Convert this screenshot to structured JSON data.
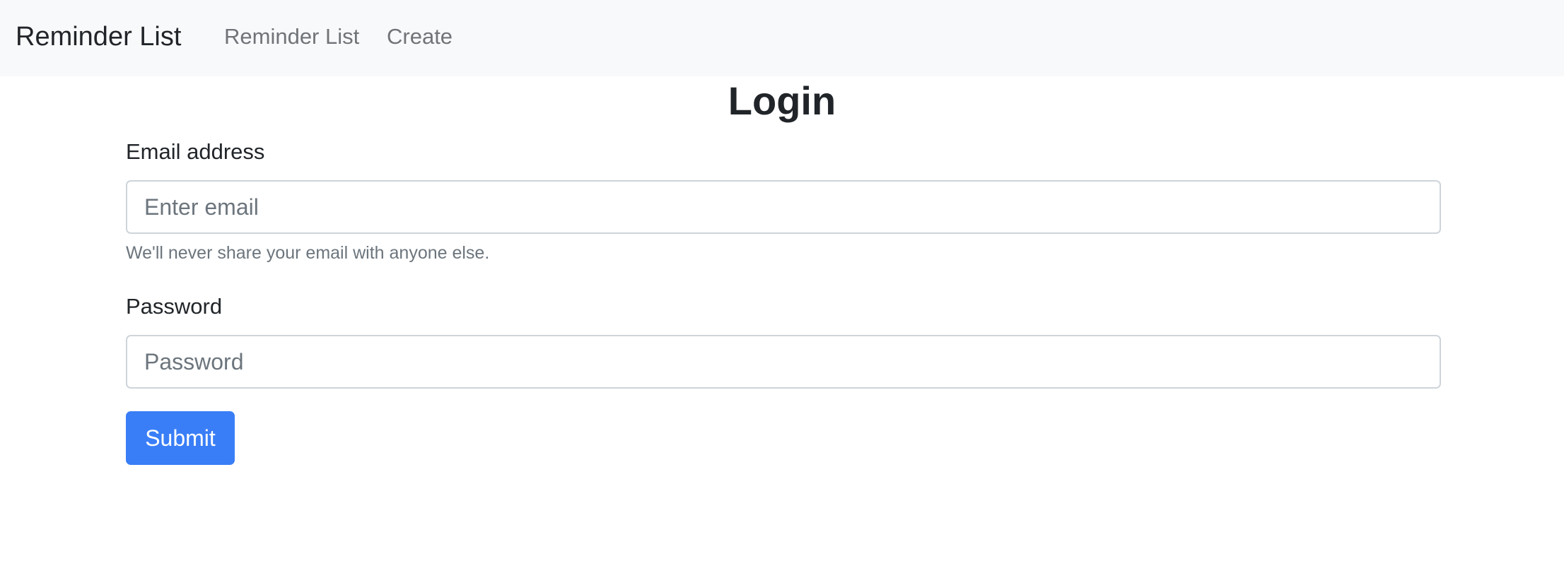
{
  "navbar": {
    "brand": "Reminder List",
    "links": [
      "Reminder List",
      "Create"
    ]
  },
  "page": {
    "title": "Login"
  },
  "form": {
    "email": {
      "label": "Email address",
      "placeholder": "Enter email",
      "value": "",
      "help": "We'll never share your email with anyone else."
    },
    "password": {
      "label": "Password",
      "placeholder": "Password",
      "value": ""
    },
    "submit_label": "Submit"
  },
  "colors": {
    "navbar_bg": "#f8f9fa",
    "primary": "#3a7ef7",
    "muted_text": "#6c757d",
    "text": "#212529"
  }
}
